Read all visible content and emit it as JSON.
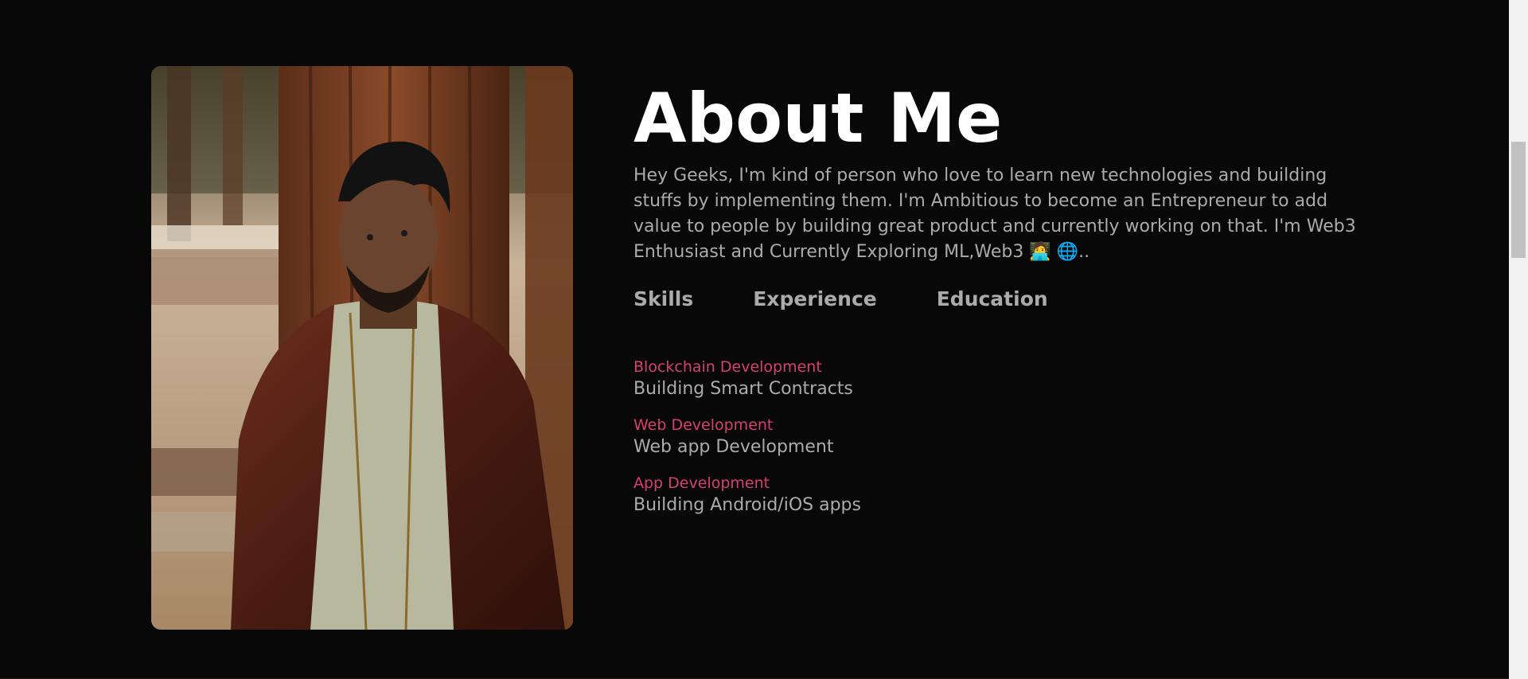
{
  "about": {
    "title": "About Me",
    "intro": "Hey Geeks, I'm kind of person who love to learn new technologies and building stuffs by implementing them. I'm Ambitious to become an Entrepreneur to add value to people by building great product and currently working on that. I'm Web3 Enthusiast and Currently Exploring ML,Web3 🧑‍💻 🌐..",
    "tabs": [
      {
        "label": "Skills"
      },
      {
        "label": "Experience"
      },
      {
        "label": "Education"
      }
    ],
    "skills": [
      {
        "name": "Blockchain Development",
        "desc": "Building Smart Contracts"
      },
      {
        "name": "Web Development",
        "desc": "Web app Development"
      },
      {
        "name": "App Development",
        "desc": "Building Android/iOS apps"
      }
    ]
  },
  "colors": {
    "background": "#080808",
    "accent": "#d6406e",
    "text": "#ababab",
    "title": "#ffffff"
  }
}
